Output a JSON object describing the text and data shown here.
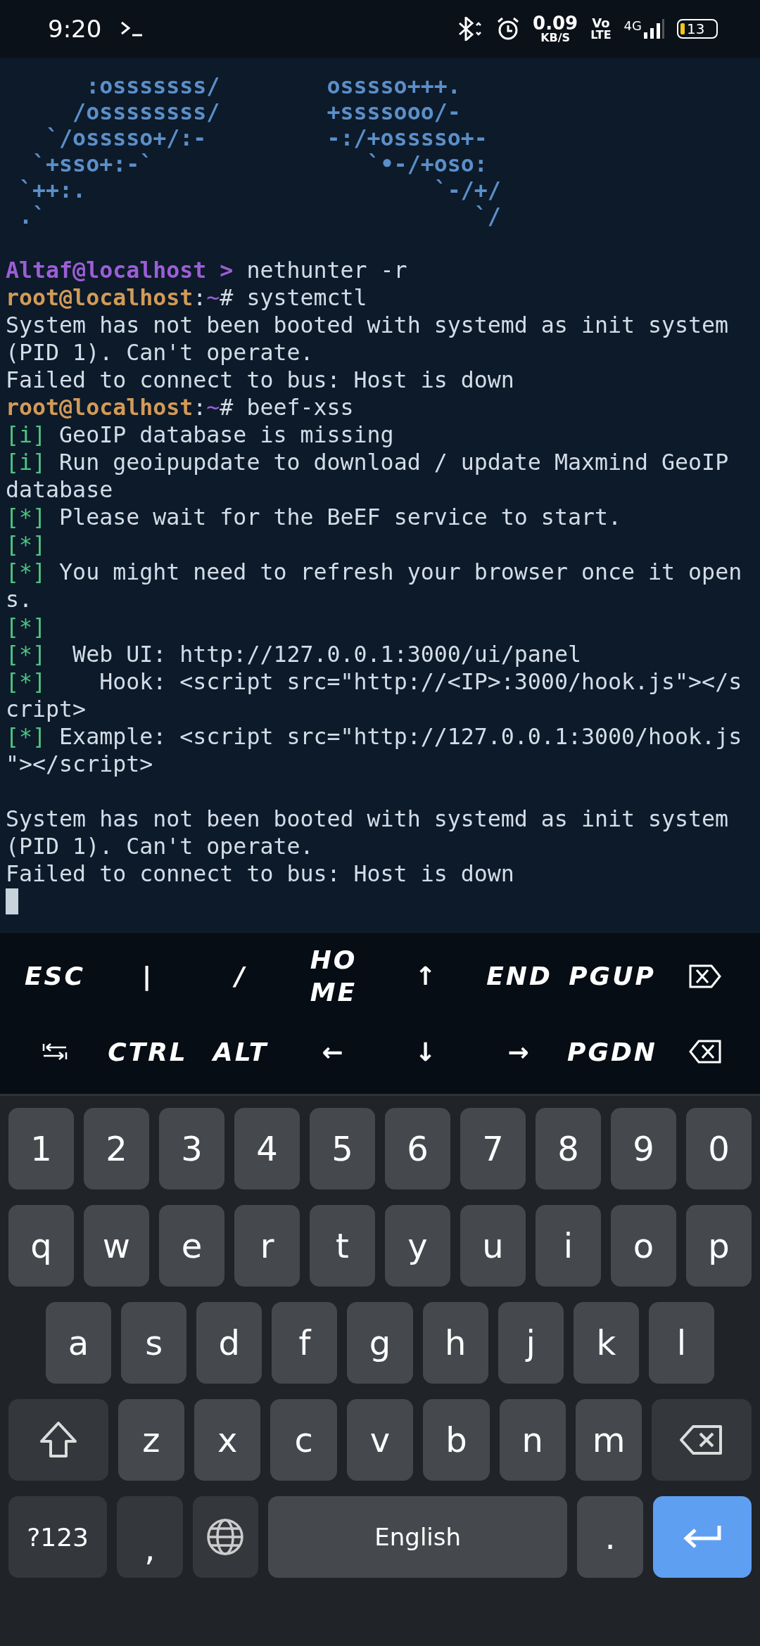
{
  "status_bar": {
    "time": "9:20",
    "net_speed": "0.09",
    "net_unit": "KB/S",
    "volte_top": "Vo",
    "volte_bottom": "LTE",
    "network": "4G",
    "battery": "13"
  },
  "terminal": {
    "lines": [
      {
        "kind": "art",
        "text": "      :osssssss/        osssso+++."
      },
      {
        "kind": "art",
        "text": "     /ossssssss/        +ssssooo/-"
      },
      {
        "kind": "art",
        "text": "   `/osssso+/:-         -:/+osssso+-"
      },
      {
        "kind": "art",
        "text": "  `+sso+:-`                `•-/+oso:"
      },
      {
        "kind": "art",
        "text": " `++:.                          `-/+/"
      },
      {
        "kind": "art",
        "text": " .`                                `/"
      },
      {
        "kind": "blank"
      },
      {
        "kind": "output",
        "segments": [
          {
            "kind": "user",
            "text": "Altaf@localhost > "
          },
          {
            "kind": "text",
            "text": "nethunter -r"
          }
        ]
      },
      {
        "kind": "output",
        "segments": [
          {
            "kind": "root",
            "text": "root@localhost"
          },
          {
            "kind": "text",
            "text": ":"
          },
          {
            "kind": "path",
            "text": "~"
          },
          {
            "kind": "text",
            "text": "# systemctl"
          }
        ]
      },
      {
        "kind": "output",
        "segments": [
          {
            "kind": "text",
            "text": "System has not been booted with systemd as init system"
          }
        ]
      },
      {
        "kind": "output",
        "segments": [
          {
            "kind": "text",
            "text": "(PID 1). Can't operate."
          }
        ]
      },
      {
        "kind": "output",
        "segments": [
          {
            "kind": "text",
            "text": "Failed to connect to bus: Host is down"
          }
        ]
      },
      {
        "kind": "output",
        "segments": [
          {
            "kind": "root",
            "text": "root@localhost"
          },
          {
            "kind": "text",
            "text": ":"
          },
          {
            "kind": "path",
            "text": "~"
          },
          {
            "kind": "text",
            "text": "# beef-xss"
          }
        ]
      },
      {
        "kind": "output",
        "segments": [
          {
            "kind": "tag",
            "text": "[i]"
          },
          {
            "kind": "text",
            "text": " GeoIP database is missing"
          }
        ]
      },
      {
        "kind": "output",
        "segments": [
          {
            "kind": "tag",
            "text": "[i]"
          },
          {
            "kind": "text",
            "text": " Run geoipupdate to download / update Maxmind GeoIP"
          }
        ]
      },
      {
        "kind": "output",
        "segments": [
          {
            "kind": "text",
            "text": "database"
          }
        ]
      },
      {
        "kind": "output",
        "segments": [
          {
            "kind": "tag",
            "text": "[*]"
          },
          {
            "kind": "text",
            "text": " Please wait for the BeEF service to start."
          }
        ]
      },
      {
        "kind": "output",
        "segments": [
          {
            "kind": "tag",
            "text": "[*]"
          }
        ]
      },
      {
        "kind": "output",
        "segments": [
          {
            "kind": "tag",
            "text": "[*]"
          },
          {
            "kind": "text",
            "text": " You might need to refresh your browser once it open"
          }
        ]
      },
      {
        "kind": "output",
        "segments": [
          {
            "kind": "text",
            "text": "s."
          }
        ]
      },
      {
        "kind": "output",
        "segments": [
          {
            "kind": "tag",
            "text": "[*]"
          }
        ]
      },
      {
        "kind": "output",
        "segments": [
          {
            "kind": "tag",
            "text": "[*]"
          },
          {
            "kind": "text",
            "text": "  Web UI: http://127.0.0.1:3000/ui/panel"
          }
        ]
      },
      {
        "kind": "output",
        "segments": [
          {
            "kind": "tag",
            "text": "[*]"
          },
          {
            "kind": "text",
            "text": "    Hook: <script src=\"http://<IP>:3000/hook.js\"></s"
          }
        ]
      },
      {
        "kind": "output",
        "segments": [
          {
            "kind": "text",
            "text": "cript>"
          }
        ]
      },
      {
        "kind": "output",
        "segments": [
          {
            "kind": "tag",
            "text": "[*]"
          },
          {
            "kind": "text",
            "text": " Example: <script src=\"http://127.0.0.1:3000/hook.js"
          }
        ]
      },
      {
        "kind": "output",
        "segments": [
          {
            "kind": "text",
            "text": "\"></script>"
          }
        ]
      },
      {
        "kind": "blank"
      },
      {
        "kind": "output",
        "segments": [
          {
            "kind": "text",
            "text": "System has not been booted with systemd as init system"
          }
        ]
      },
      {
        "kind": "output",
        "segments": [
          {
            "kind": "text",
            "text": "(PID 1). Can't operate."
          }
        ]
      },
      {
        "kind": "output",
        "segments": [
          {
            "kind": "text",
            "text": "Failed to connect to bus: Host is down"
          }
        ]
      },
      {
        "kind": "cursor"
      }
    ]
  },
  "extra_keys": [
    [
      {
        "kind": "text",
        "label": "ESC"
      },
      {
        "kind": "text",
        "label": "|"
      },
      {
        "kind": "text",
        "label": "/"
      },
      {
        "kind": "wrap",
        "label": "HOME"
      },
      {
        "kind": "text",
        "label": "↑"
      },
      {
        "kind": "text",
        "label": "END"
      },
      {
        "kind": "text",
        "label": "PGUP"
      },
      {
        "kind": "delete"
      }
    ],
    [
      {
        "kind": "tab"
      },
      {
        "kind": "text",
        "label": "CTRL"
      },
      {
        "kind": "text",
        "label": "ALT"
      },
      {
        "kind": "text",
        "label": "←"
      },
      {
        "kind": "text",
        "label": "↓"
      },
      {
        "kind": "text",
        "label": "→"
      },
      {
        "kind": "text",
        "label": "PGDN"
      },
      {
        "kind": "backspace"
      }
    ]
  ],
  "keyboard": {
    "rows": [
      {
        "keys": [
          {
            "kind": "char",
            "label": "1"
          },
          {
            "kind": "char",
            "label": "2"
          },
          {
            "kind": "char",
            "label": "3"
          },
          {
            "kind": "char",
            "label": "4"
          },
          {
            "kind": "char",
            "label": "5"
          },
          {
            "kind": "char",
            "label": "6"
          },
          {
            "kind": "char",
            "label": "7"
          },
          {
            "kind": "char",
            "label": "8"
          },
          {
            "kind": "char",
            "label": "9"
          },
          {
            "kind": "char",
            "label": "0"
          }
        ]
      },
      {
        "keys": [
          {
            "kind": "char",
            "label": "q"
          },
          {
            "kind": "char",
            "label": "w"
          },
          {
            "kind": "char",
            "label": "e"
          },
          {
            "kind": "char",
            "label": "r"
          },
          {
            "kind": "char",
            "label": "t"
          },
          {
            "kind": "char",
            "label": "y"
          },
          {
            "kind": "char",
            "label": "u"
          },
          {
            "kind": "char",
            "label": "i"
          },
          {
            "kind": "char",
            "label": "o"
          },
          {
            "kind": "char",
            "label": "p"
          }
        ]
      },
      {
        "keys": [
          {
            "kind": "char",
            "label": "a"
          },
          {
            "kind": "char",
            "label": "s"
          },
          {
            "kind": "char",
            "label": "d"
          },
          {
            "kind": "char",
            "label": "f"
          },
          {
            "kind": "char",
            "label": "g"
          },
          {
            "kind": "char",
            "label": "h"
          },
          {
            "kind": "char",
            "label": "j"
          },
          {
            "kind": "char",
            "label": "k"
          },
          {
            "kind": "char",
            "label": "l"
          }
        ]
      },
      {
        "keys": [
          {
            "kind": "shift"
          },
          {
            "kind": "char",
            "label": "z"
          },
          {
            "kind": "char",
            "label": "x"
          },
          {
            "kind": "char",
            "label": "c"
          },
          {
            "kind": "char",
            "label": "v"
          },
          {
            "kind": "char",
            "label": "b"
          },
          {
            "kind": "char",
            "label": "n"
          },
          {
            "kind": "char",
            "label": "m"
          },
          {
            "kind": "backspace"
          }
        ]
      },
      {
        "keys": [
          {
            "kind": "symbols",
            "label": "?123"
          },
          {
            "kind": "comma",
            "label": ","
          },
          {
            "kind": "globe"
          },
          {
            "kind": "space",
            "label": "English"
          },
          {
            "kind": "char",
            "label": "."
          },
          {
            "kind": "enter"
          }
        ]
      }
    ]
  }
}
